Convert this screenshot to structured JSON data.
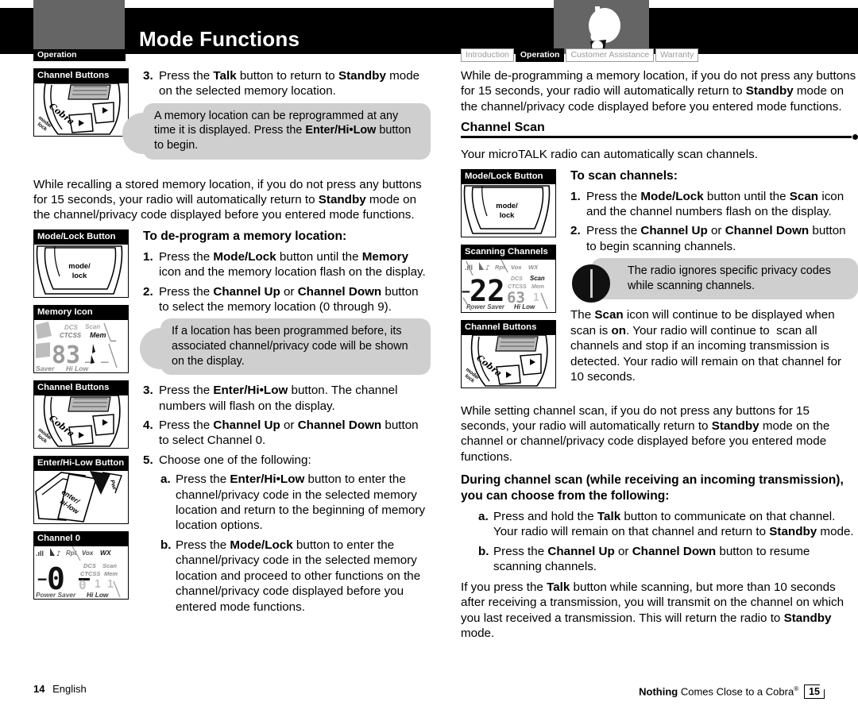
{
  "header": {
    "title": "Mode Functions",
    "left_tab": "Operation",
    "tabs": [
      {
        "label": "Introduction",
        "active": false
      },
      {
        "label": "Operation",
        "active": true
      },
      {
        "label": "Customer Assistance",
        "active": false
      },
      {
        "label": "Warranty",
        "active": false
      }
    ],
    "icon": "walkie-talkie-icon"
  },
  "left_page": {
    "step3": {
      "num": "3.",
      "text_parts": [
        "Press the ",
        "Talk",
        " button to return to ",
        "Standby",
        " mode on the selected memory location."
      ]
    },
    "figure_channel_buttons_1": {
      "caption": "Channel Buttons",
      "art": "radio-channel-buttons-photo"
    },
    "callout1": "A memory location can be reprogrammed at any time it is displayed. Press the Enter/Hi•Low button to begin.",
    "callout1_bold": "Enter/Hi•Low",
    "para1": "While recalling a stored memory location, if you do not press any buttons for 15 seconds, your radio will automatically return to Standby mode on the channel/privacy code displayed before you entered mode functions.",
    "para1_bold": "Standby",
    "heading_deprogram": "To de-program a memory location:",
    "figure_mode_lock": {
      "caption": "Mode/Lock Button",
      "key_line1": "mode/",
      "key_line2": "lock"
    },
    "figure_memory_icon": {
      "caption": "Memory Icon",
      "lcd_big": "83",
      "lcd_labels": [
        "DCS",
        "Scan",
        "CTCSS",
        "Mem",
        "Saver",
        "Hi Low"
      ]
    },
    "figure_channel_buttons_2": {
      "caption": "Channel Buttons"
    },
    "figure_enter_hilow": {
      "caption": "Enter/Hi-Low Button",
      "key_line1": "enter/",
      "key_line2": "hi-low"
    },
    "figure_channel_0": {
      "caption": "Channel 0",
      "lcd_big": "0",
      "lcd_labels": [
        "Rpt",
        "Vox",
        "WX",
        "DCS",
        "Scan",
        "CTCSS",
        "Mem",
        "Power Saver",
        "Hi Low"
      ]
    },
    "steps": [
      {
        "num": "1.",
        "text": "Press the Mode/Lock button until the Memory icon and the memory location flash on the display.",
        "bold": [
          "Mode/Lock",
          "Memory"
        ]
      },
      {
        "num": "2.",
        "text": "Press the Channel Up or Channel Down button to select the memory location (0 through 9).",
        "bold": [
          "Channel Up",
          "Channel Down"
        ]
      },
      {
        "num": "3.",
        "text": "Press the Enter/Hi•Low button. The channel numbers will flash on the display.",
        "bold": [
          "Enter/Hi•Low"
        ]
      },
      {
        "num": "4.",
        "text": "Press the Channel Up or Channel Down button to select Channel 0.",
        "bold": [
          "Channel Up",
          "Channel Down"
        ]
      },
      {
        "num": "5.",
        "text": "Choose one of the following:",
        "bold": []
      }
    ],
    "callout2": "If a location has been programmed before, its associated channel/privacy code will be shown on the display.",
    "substeps": [
      {
        "num": "a.",
        "text": "Press the Enter/Hi•Low button to enter the channel/privacy code in the selected memory location and return to the beginning of memory location options.",
        "bold": [
          "Enter/Hi•Low"
        ]
      },
      {
        "num": "b.",
        "text": "Press the Mode/Lock button to enter the channel/privacy code in the selected memory location and proceed to other functions on the channel/privacy code displayed before you entered mode functions.",
        "bold": [
          "Mode/Lock"
        ]
      }
    ]
  },
  "right_page": {
    "para1": "While de-programming a memory location, if you do not press any buttons for 15 seconds, your radio will automatically return to Standby mode on the channel/privacy code displayed before you entered mode functions.",
    "para1_bold": "Standby",
    "section_title": "Channel Scan",
    "intro": "Your microTALK radio can automatically scan channels.",
    "heading_scan": "To scan channels:",
    "figure_mode_lock": {
      "caption": "Mode/Lock Button",
      "key_line1": "mode/",
      "key_line2": "lock"
    },
    "figure_scanning": {
      "caption": "Scanning Channels",
      "lcd_big": "22",
      "lcd_small": "63",
      "lcd_labels": [
        "Rpt",
        "Vox",
        "WX",
        "DCS",
        "Scan",
        "CTCSS",
        "Mem",
        "Power Saver",
        "Hi Low"
      ]
    },
    "figure_channel_buttons": {
      "caption": "Channel Buttons"
    },
    "steps": [
      {
        "num": "1.",
        "text": "Press the Mode/Lock button until the Scan icon and the channel numbers flash on the display.",
        "bold": [
          "Mode/Lock",
          "Scan"
        ]
      },
      {
        "num": "2.",
        "text": "Press the Channel Up or Channel Down button to begin scanning channels.",
        "bold": [
          "Channel Up",
          "Channel Down"
        ]
      }
    ],
    "callout": "The radio ignores specific privacy codes while scanning channels.",
    "callout_icon": "note-circle-icon",
    "para_scan_on": "The Scan icon will continue to be displayed when scan is on. Your radio will continue to scan all channels and stop if an incoming transmission is detected. Your radio will remain on that channel for 10 seconds.",
    "para2": "While setting channel scan, if you do not press any buttons for 15 seconds, your radio will automatically return to Standby mode on the channel or channel/privacy code displayed before you entered mode functions.",
    "heading_during": "During channel scan (while receiving an incoming transmission), you can choose from the following:",
    "substeps": [
      {
        "num": "a.",
        "text": "Press and hold the Talk button to communicate on that channel. Your radio will remain on that channel and return to Standby mode.",
        "bold": [
          "Talk",
          "Standby"
        ]
      },
      {
        "num": "b.",
        "text": "Press the Channel Up or Channel Down button to resume scanning channels.",
        "bold": [
          "Channel Up",
          "Channel Down"
        ]
      }
    ],
    "para3": "If you press the Talk button while scanning, but more than 10 seconds after receiving a transmission, you will transmit on the channel on which you last received a transmission. This will return the radio to Standby mode."
  },
  "footer": {
    "left_page_number": "14",
    "left_language": "English",
    "tagline_bold": "Nothing",
    "tagline_rest": " Comes Close to a Cobra",
    "registered_mark": "®",
    "right_page_number": "15"
  },
  "colors": {
    "black": "#000000",
    "gray_block": "#656565",
    "callout_gray": "#cfcfcf",
    "tab_inactive": "#9a9a9a"
  }
}
